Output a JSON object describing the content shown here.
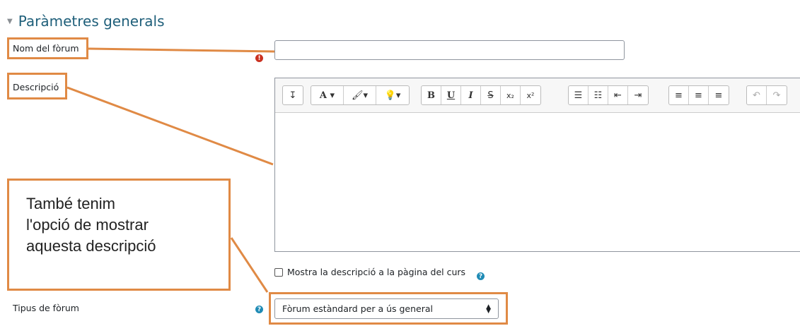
{
  "section": {
    "title": "Paràmetres generals"
  },
  "fields": {
    "forum_name_label": "Nom del fòrum",
    "description_label": "Descripció",
    "forum_type_label": "Tipus de fòrum",
    "show_description_label": "Mostra la descripció a la pàgina del curs",
    "forum_type_value": "Fòrum estàndard per a ús general"
  },
  "toolbar": {
    "buttons": [
      "↧",
      "A▾",
      "🖌▾",
      "💡▾",
      "B",
      "U",
      "I",
      "S",
      "x₂",
      "x²",
      "bullet-list",
      "numbered-list",
      "outdent",
      "indent",
      "align-left",
      "align-center",
      "align-right",
      "undo",
      "redo"
    ]
  },
  "callout": {
    "line1": "També tenim",
    "line2": "l'opció de mostrar",
    "line3": "aquesta descripció"
  },
  "colors": {
    "accent": "#e08a45",
    "heading": "#1f5f7a",
    "required": "#ca3120",
    "help": "#1f8bb5"
  }
}
